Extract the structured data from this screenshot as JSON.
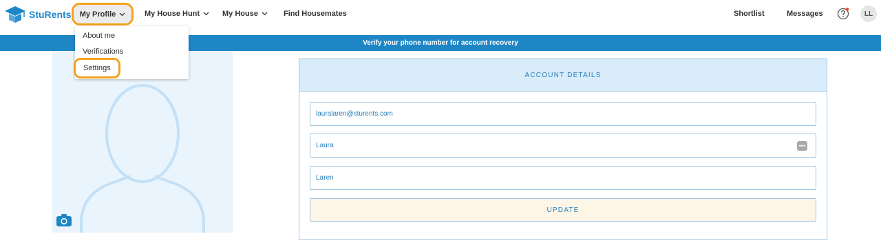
{
  "brand": {
    "name": "StuRents"
  },
  "nav": {
    "my_profile": "My Profile",
    "house_hunt": "My House Hunt",
    "my_house": "My House",
    "find_housemates": "Find Housemates",
    "shortlist": "Shortlist",
    "messages": "Messages",
    "avatar_initials": "LL"
  },
  "dropdown": {
    "items": [
      "About me",
      "Verifications",
      "Settings"
    ]
  },
  "banner": {
    "text": "Verify your phone number for account recovery"
  },
  "account": {
    "heading": "ACCOUNT DETAILS",
    "email": "lauralaren@sturents.com",
    "first_name": "Laura",
    "last_name": "Laren",
    "update_label": "UPDATE"
  },
  "colors": {
    "brand_blue": "#1f86c6",
    "highlight_orange": "#f4a21c",
    "panel_light_blue": "#d8ecfa",
    "update_bg": "#fdf5e6"
  },
  "icons": [
    "graduation-cap-logo-icon",
    "chevron-down-icon",
    "help-icon",
    "notification-dot-icon",
    "camera-icon",
    "password-manager-icon"
  ]
}
